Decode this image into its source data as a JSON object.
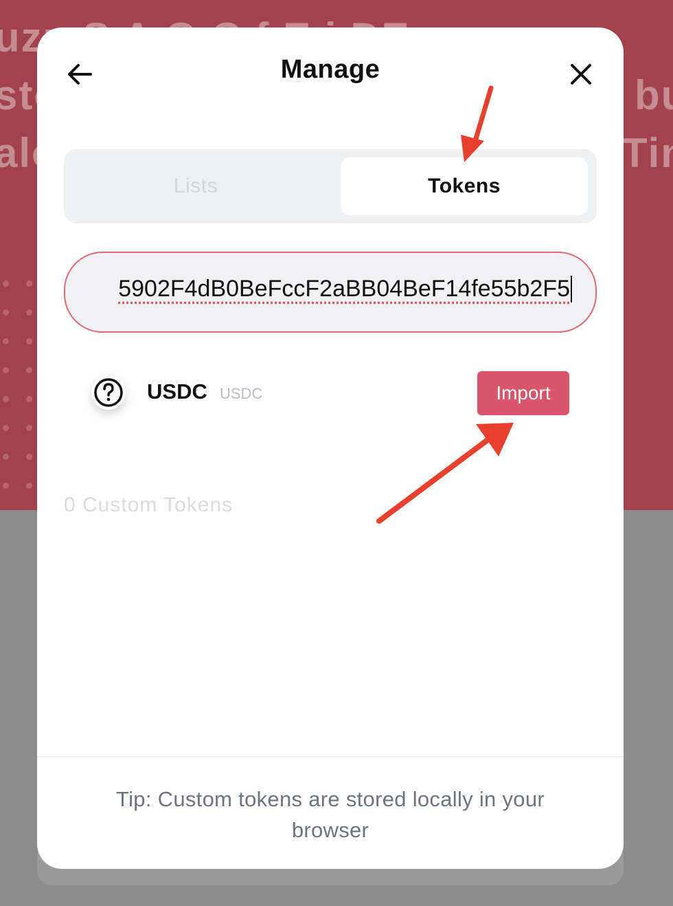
{
  "background": {
    "fragments": [
      "uzu S  A  O  C  f  E  i DE",
      "sto",
      "bu",
      "alo",
      "Tin"
    ]
  },
  "modal": {
    "title": "Manage",
    "back_icon": "arrow-left-icon",
    "close_icon": "close-icon",
    "tabs": [
      {
        "label": "Lists",
        "active": false
      },
      {
        "label": "Tokens",
        "active": true
      }
    ],
    "search": {
      "value": "5902F4dB0BeFccF2aBB04BeF14fe55b2F5"
    },
    "token": {
      "icon": "question-circle-icon",
      "name": "USDC",
      "symbol": "USDC",
      "import_label": "Import"
    },
    "custom_tokens": "0 Custom Tokens",
    "tip": "Tip: Custom tokens are stored locally in your browser"
  },
  "colors": {
    "accent": "#d9566a",
    "background_red": "#a2424c",
    "annotation_arrow": "#e8402c"
  }
}
